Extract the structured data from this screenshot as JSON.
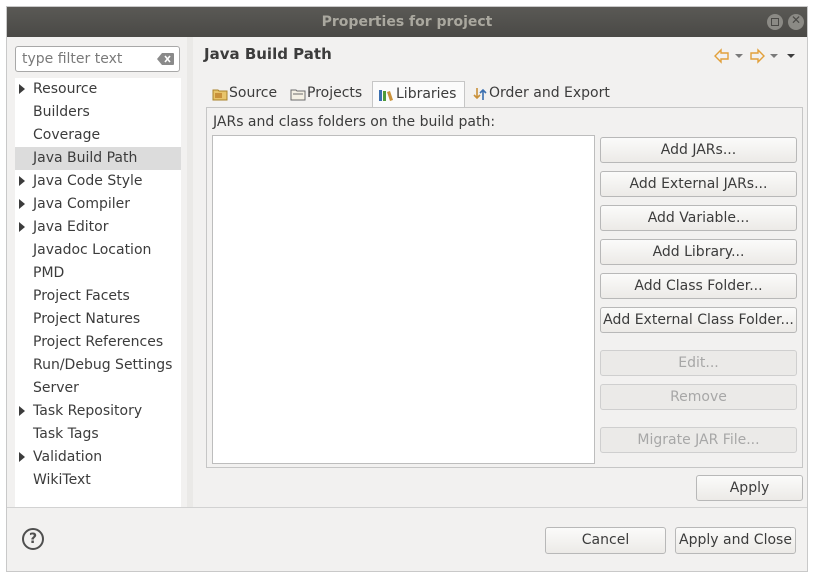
{
  "window": {
    "title": "Properties for project"
  },
  "filter": {
    "placeholder": "type filter text",
    "value": ""
  },
  "tree": {
    "items": [
      {
        "label": "Resource",
        "expandable": true
      },
      {
        "label": "Builders",
        "expandable": false
      },
      {
        "label": "Coverage",
        "expandable": false
      },
      {
        "label": "Java Build Path",
        "expandable": false,
        "selected": true
      },
      {
        "label": "Java Code Style",
        "expandable": true
      },
      {
        "label": "Java Compiler",
        "expandable": true
      },
      {
        "label": "Java Editor",
        "expandable": true
      },
      {
        "label": "Javadoc Location",
        "expandable": false
      },
      {
        "label": "PMD",
        "expandable": false
      },
      {
        "label": "Project Facets",
        "expandable": false
      },
      {
        "label": "Project Natures",
        "expandable": false
      },
      {
        "label": "Project References",
        "expandable": false
      },
      {
        "label": "Run/Debug Settings",
        "expandable": false
      },
      {
        "label": "Server",
        "expandable": false
      },
      {
        "label": "Task Repository",
        "expandable": true
      },
      {
        "label": "Task Tags",
        "expandable": false
      },
      {
        "label": "Validation",
        "expandable": true
      },
      {
        "label": "WikiText",
        "expandable": false
      }
    ]
  },
  "page": {
    "title": "Java Build Path",
    "tabs": [
      {
        "label": "Source",
        "icon": "source-folder-icon"
      },
      {
        "label": "Projects",
        "icon": "project-icon"
      },
      {
        "label": "Libraries",
        "icon": "libraries-icon",
        "active": true
      },
      {
        "label": "Order and Export",
        "icon": "order-export-icon"
      }
    ],
    "list_label": "JARs and class folders on the build path:",
    "buttons": {
      "add_jars": "Add JARs...",
      "add_external_jars": "Add External JARs...",
      "add_variable": "Add Variable...",
      "add_library": "Add Library...",
      "add_class_folder": "Add Class Folder...",
      "add_external_class_folder": "Add External Class Folder...",
      "edit": "Edit...",
      "remove": "Remove",
      "migrate_jar": "Migrate JAR File..."
    },
    "apply": "Apply"
  },
  "footer": {
    "help": "?",
    "cancel": "Cancel",
    "apply_and_close": "Apply and Close"
  },
  "colors": {
    "nav_arrow": "#e2a03a",
    "selected_row": "#dcdcdc",
    "titlebar": "#4a4946"
  }
}
